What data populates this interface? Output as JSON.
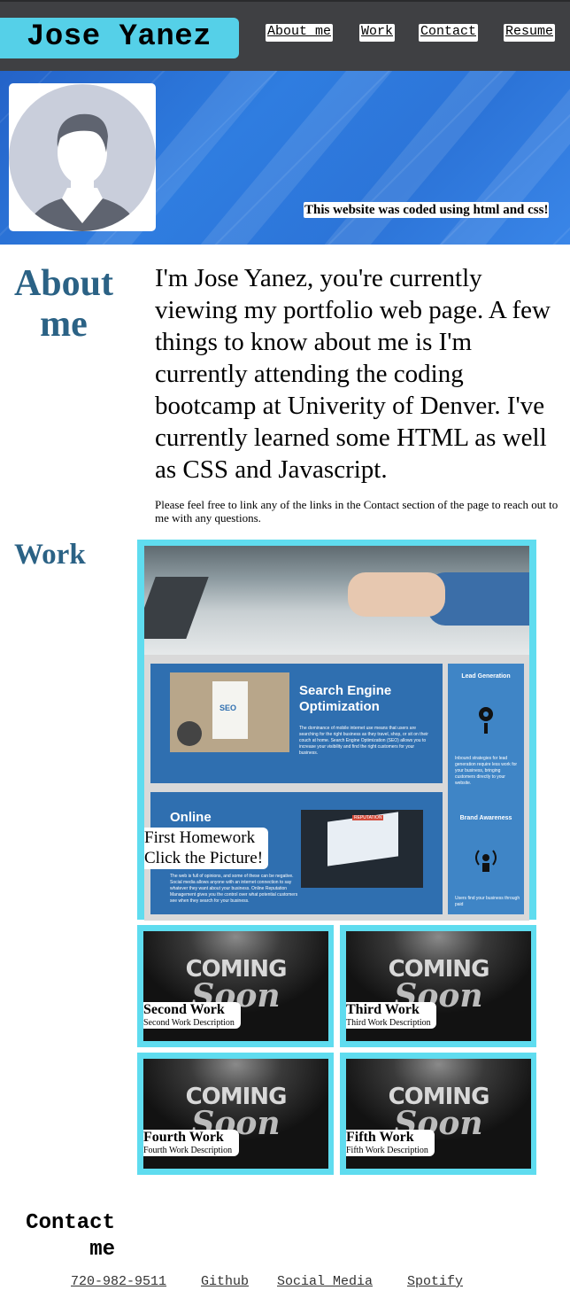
{
  "header": {
    "logo": "Jose Yanez",
    "nav": [
      "About me",
      "Work",
      "Contact",
      "Resume"
    ]
  },
  "hero": {
    "caption": "This website was coded using html and css!"
  },
  "about": {
    "title": "About me",
    "paragraph": "I'm Jose Yanez, you're currently viewing my portfolio web page. A few things to know about me is I'm currently attending the coding bootcamp at Univerity of Denver. I've currently learned some HTML as well as CSS and Javascript.",
    "note": "Please feel free to link any of the links in the Contact section of the page to reach out to me with any questions."
  },
  "work": {
    "title": "Work",
    "featured": {
      "title": "First Homework",
      "subtitle": "Click the Picture!",
      "image": {
        "seo_heading": "Search Engine Optimization",
        "seo_body": "The dominance of mobile internet use means that users are searching for the right business as they travel, shop, or sit on their couch at home. Search Engine Optimization (SEO) allows you to increase your visibility and find the right customers for your business.",
        "online_heading": "Online",
        "online_body": "The web is full of opinions, and some of these can be negative. Social media allows anyone with an internet connection to say whatever they want about your business. Online Reputation Management gives you the control over what potential customers see when they search for your business.",
        "side_lead": "Lead Generation",
        "side_lead_body": "Inbound strategies for lead generation require less work for your business, bringing customers directly to your website.",
        "side_brand": "Brand Awareness",
        "side_brand_body": "Users find your business through paid",
        "reputation_label": "REPUTATION",
        "seo_label": "SEO"
      }
    },
    "items": [
      {
        "title": "Second Work",
        "desc": "Second Work Description"
      },
      {
        "title": "Third Work",
        "desc": "Third Work Description"
      },
      {
        "title": "Fourth Work",
        "desc": "Fourth Work Description"
      },
      {
        "title": "Fifth Work",
        "desc": "Fifth Work Description"
      }
    ],
    "placeholder_top": "COMING",
    "placeholder_bottom": "Soon"
  },
  "contact": {
    "title_line1": "Contact",
    "title_line2": "me",
    "links": [
      "720-982-9511",
      "Github",
      "Social Media",
      "Spotify"
    ]
  },
  "colors": {
    "header_bg": "#3f4043",
    "accent": "#55d0e8",
    "card_border": "#5fdcef",
    "title_blue": "#2b6285",
    "hero_blue": "#2f7de0"
  }
}
